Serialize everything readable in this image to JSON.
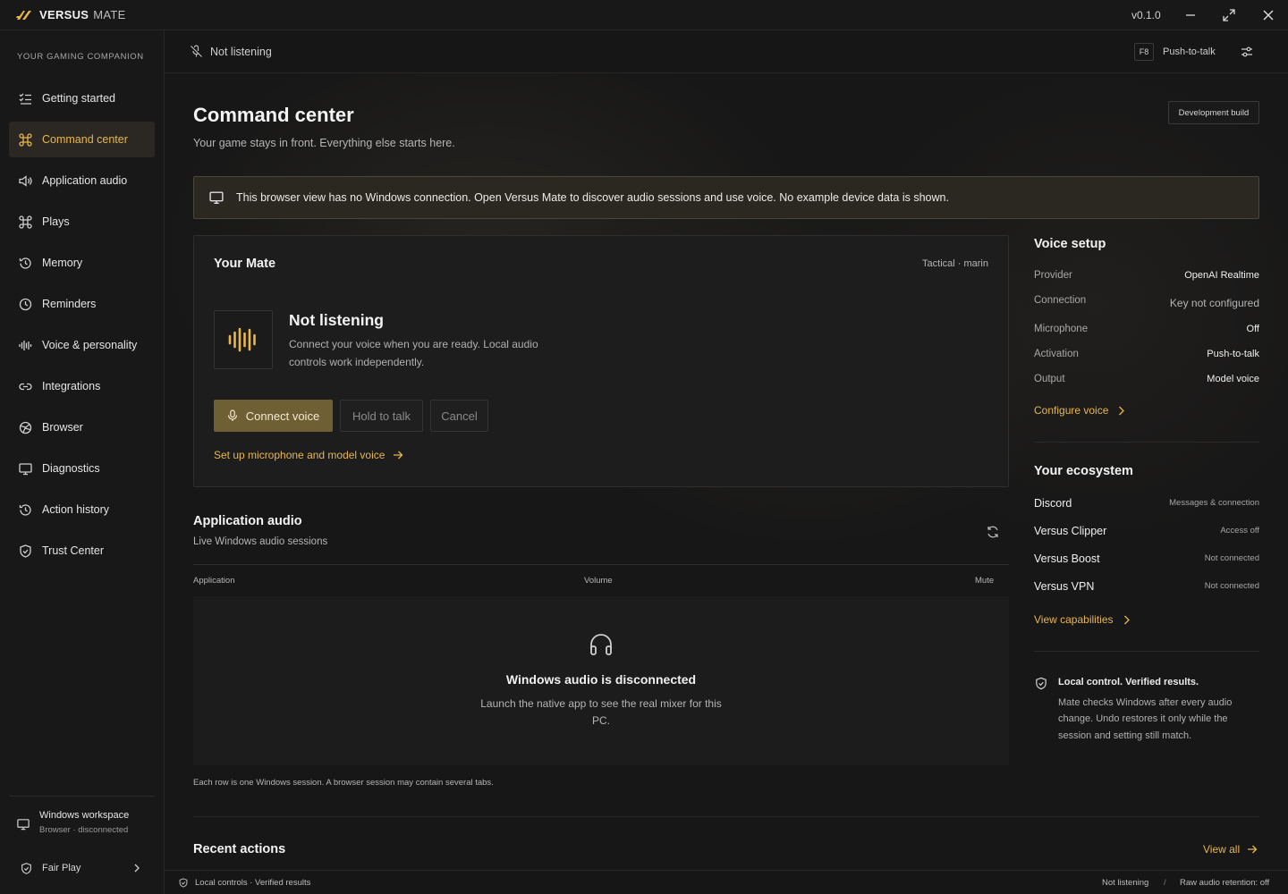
{
  "app": {
    "brand": "VERSUS",
    "brand_sub": "MATE",
    "version": "v0.1.0"
  },
  "sidebar": {
    "tagline": "YOUR GAMING COMPANION",
    "items": [
      {
        "label": "Getting started",
        "icon": "checklist-icon"
      },
      {
        "label": "Command center",
        "icon": "command-icon",
        "active": true
      },
      {
        "label": "Application audio",
        "icon": "speaker-icon"
      },
      {
        "label": "Plays",
        "icon": "command-icon"
      },
      {
        "label": "Memory",
        "icon": "history-icon"
      },
      {
        "label": "Reminders",
        "icon": "clock-icon"
      },
      {
        "label": "Voice & personality",
        "icon": "waveform-icon"
      },
      {
        "label": "Integrations",
        "icon": "link-icon"
      },
      {
        "label": "Browser",
        "icon": "globe-icon"
      },
      {
        "label": "Diagnostics",
        "icon": "monitor-icon"
      },
      {
        "label": "Action history",
        "icon": "history-icon"
      },
      {
        "label": "Trust Center",
        "icon": "shield-icon"
      }
    ],
    "workspace": {
      "title": "Windows workspace",
      "subtitle": "Browser · disconnected"
    },
    "fair_play": "Fair Play"
  },
  "topbar": {
    "status": "Not listening",
    "hotkey": "F8",
    "mode": "Push-to-talk"
  },
  "header": {
    "title": "Command center",
    "subtitle": "Your game stays in front. Everything else starts here.",
    "badge": "Development build"
  },
  "banner": {
    "text": "This browser view has no Windows connection. Open Versus Mate to discover audio sessions and use voice. No example device data is shown."
  },
  "mate": {
    "title": "Your Mate",
    "meta": "Tactical · marin",
    "status_title": "Not listening",
    "status_desc_line1": "Connect your voice when you are ready. Local audio",
    "status_desc_line2": "controls work independently.",
    "connect_label": "Connect voice",
    "hold_label": "Hold to talk",
    "cancel_label": "Cancel",
    "setup_link": "Set up microphone and model voice"
  },
  "app_audio": {
    "title": "Application audio",
    "subtitle": "Live Windows audio sessions",
    "columns": [
      "Application",
      "Volume",
      "Mute"
    ],
    "empty_title": "Windows audio is disconnected",
    "empty_desc_line1": "Launch the native app to see the real mixer for this",
    "empty_desc_line2": "PC.",
    "footnote": "Each row is one Windows session. A browser session may contain several tabs."
  },
  "recent": {
    "title": "Recent actions",
    "view_all": "View all"
  },
  "voice_setup": {
    "title": "Voice setup",
    "rows": [
      {
        "label": "Provider",
        "value": "OpenAI Realtime"
      },
      {
        "label": "Connection",
        "value": "Key not configured"
      },
      {
        "label": "Microphone",
        "value": "Off"
      },
      {
        "label": "Activation",
        "value": "Push-to-talk"
      },
      {
        "label": "Output",
        "value": "Model voice"
      }
    ],
    "link": "Configure voice"
  },
  "ecosystem": {
    "title": "Your ecosystem",
    "rows": [
      {
        "name": "Discord",
        "status": "Messages & connection"
      },
      {
        "name": "Versus Clipper",
        "status": "Access off"
      },
      {
        "name": "Versus Boost",
        "status": "Not connected"
      },
      {
        "name": "Versus VPN",
        "status": "Not connected"
      }
    ],
    "link": "View capabilities"
  },
  "trust": {
    "title": "Local control. Verified results.",
    "line1": "Mate checks Windows after every audio",
    "line2": "change. Undo restores it only while the",
    "line3": "session and setting still match."
  },
  "statusbar": {
    "left": "Local controls · Verified results",
    "right1": "Not listening",
    "sep": "/",
    "right2": "Raw audio retention: off"
  },
  "colors": {
    "accent": "#e8b64c",
    "accent_button": "#6f5f34",
    "background": "#171717",
    "sidebar": "#181818"
  }
}
